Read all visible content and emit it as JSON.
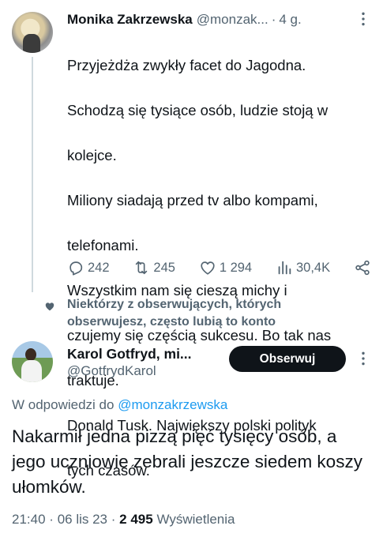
{
  "parent_tweet": {
    "author_name": "Monika Zakrzewska",
    "handle": "@monzak...",
    "separator": "·",
    "time": "4 g.",
    "text_lines": [
      "Przyjeżdża zwykły facet do Jagodna.",
      "Schodzą się tysiące osób, ludzie stoją w",
      "kolejce.",
      "Miliony siadają przed tv albo kompami,",
      "telefonami.",
      "Wszystkim nam się cieszą michy i",
      "czujemy się częścią sukcesu. Bo tak nas",
      "traktuje.",
      "Donald Tusk. Największy polski polityk",
      "tych czasów."
    ],
    "actions": {
      "replies": "242",
      "reposts": "245",
      "likes": "1 294",
      "views": "30,4K"
    }
  },
  "social_context": {
    "icon": "heart-icon",
    "text": "Niektórzy z obserwujących, których obserwujesz, często lubią to konto"
  },
  "reply_tweet": {
    "author_name": "Karol Gotfryd, mi...",
    "handle": "@GotfrydKarol",
    "follow_label": "Obserwuj",
    "reply_prefix": "W odpowiedzi do",
    "reply_mention": "@monzakrzewska",
    "text": "Nakarmił jedna pizzą pięć tysięcy osób, a jego uczniowie zebrali jeszcze siedem koszy ułomków.",
    "time": "21:40",
    "date": "06 lis 23",
    "dot": "·",
    "views_count": "2 495",
    "views_label": "Wyświetlenia"
  },
  "colors": {
    "text_primary": "#0f1419",
    "text_secondary": "#536471",
    "accent": "#1d9bf0",
    "button_bg": "#0f1419"
  }
}
